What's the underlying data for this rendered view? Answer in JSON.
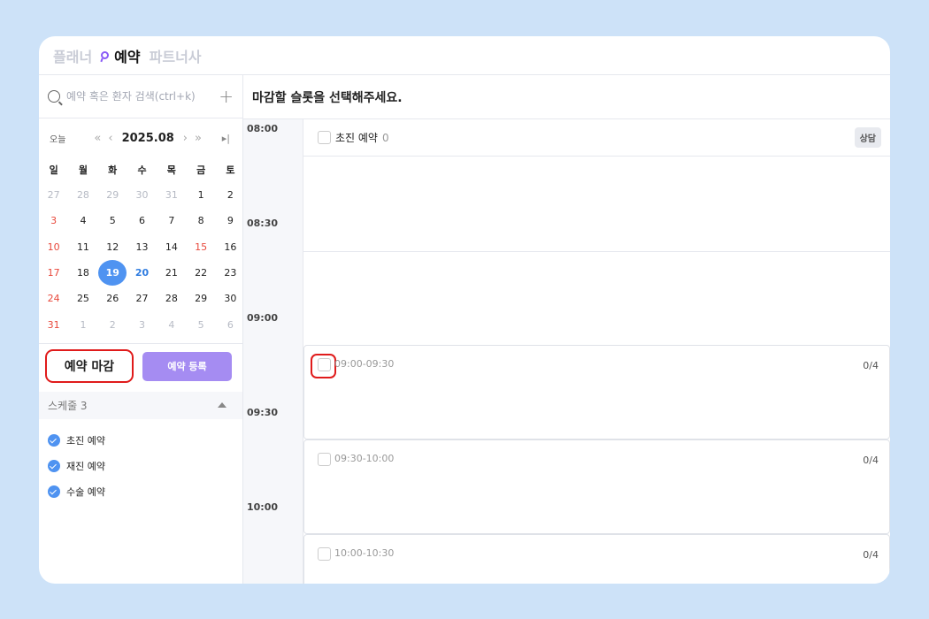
{
  "topbar": {
    "tabs": [
      {
        "label": "플래너"
      },
      {
        "label": "예약"
      },
      {
        "label": "파트너사"
      }
    ]
  },
  "search": {
    "placeholder": "예약 혹은 환자 검색(ctrl+k)",
    "value": ""
  },
  "calendar": {
    "today_label": "오늘",
    "month": "2025.08",
    "weekdays": [
      "일",
      "월",
      "화",
      "수",
      "목",
      "금",
      "토"
    ],
    "days": [
      [
        "27",
        "28",
        "29",
        "30",
        "31",
        "1",
        "2"
      ],
      [
        "3",
        "4",
        "5",
        "6",
        "7",
        "8",
        "9"
      ],
      [
        "10",
        "11",
        "12",
        "13",
        "14",
        "15",
        "16"
      ],
      [
        "17",
        "18",
        "19",
        "20",
        "21",
        "22",
        "23"
      ],
      [
        "24",
        "25",
        "26",
        "27",
        "28",
        "29",
        "30"
      ],
      [
        "31",
        "1",
        "2",
        "3",
        "4",
        "5",
        "6"
      ]
    ],
    "selected": "19",
    "colors": {
      "selected": "#4f93f1",
      "sunday": "#e8483b",
      "highlight": "#2f7ce0"
    }
  },
  "actions": {
    "close_label": "예약 마감",
    "register_label": "예약 등록"
  },
  "schedules": {
    "header": "스케줄 3",
    "items": [
      {
        "label": "초진 예약"
      },
      {
        "label": "재진 예약"
      },
      {
        "label": "수술 예약"
      }
    ]
  },
  "main": {
    "instruction": "마감할 슬롯을 선택해주세요.",
    "column": {
      "title": "초진 예약",
      "count": "0",
      "badge": "상담"
    },
    "times": [
      "08:00",
      "08:30",
      "09:00",
      "09:30",
      "10:00"
    ],
    "slots": [
      {
        "range": "09:00-09:30",
        "capacity": "0/4"
      },
      {
        "range": "09:30-10:00",
        "capacity": "0/4"
      },
      {
        "range": "10:00-10:30",
        "capacity": "0/4"
      }
    ]
  }
}
